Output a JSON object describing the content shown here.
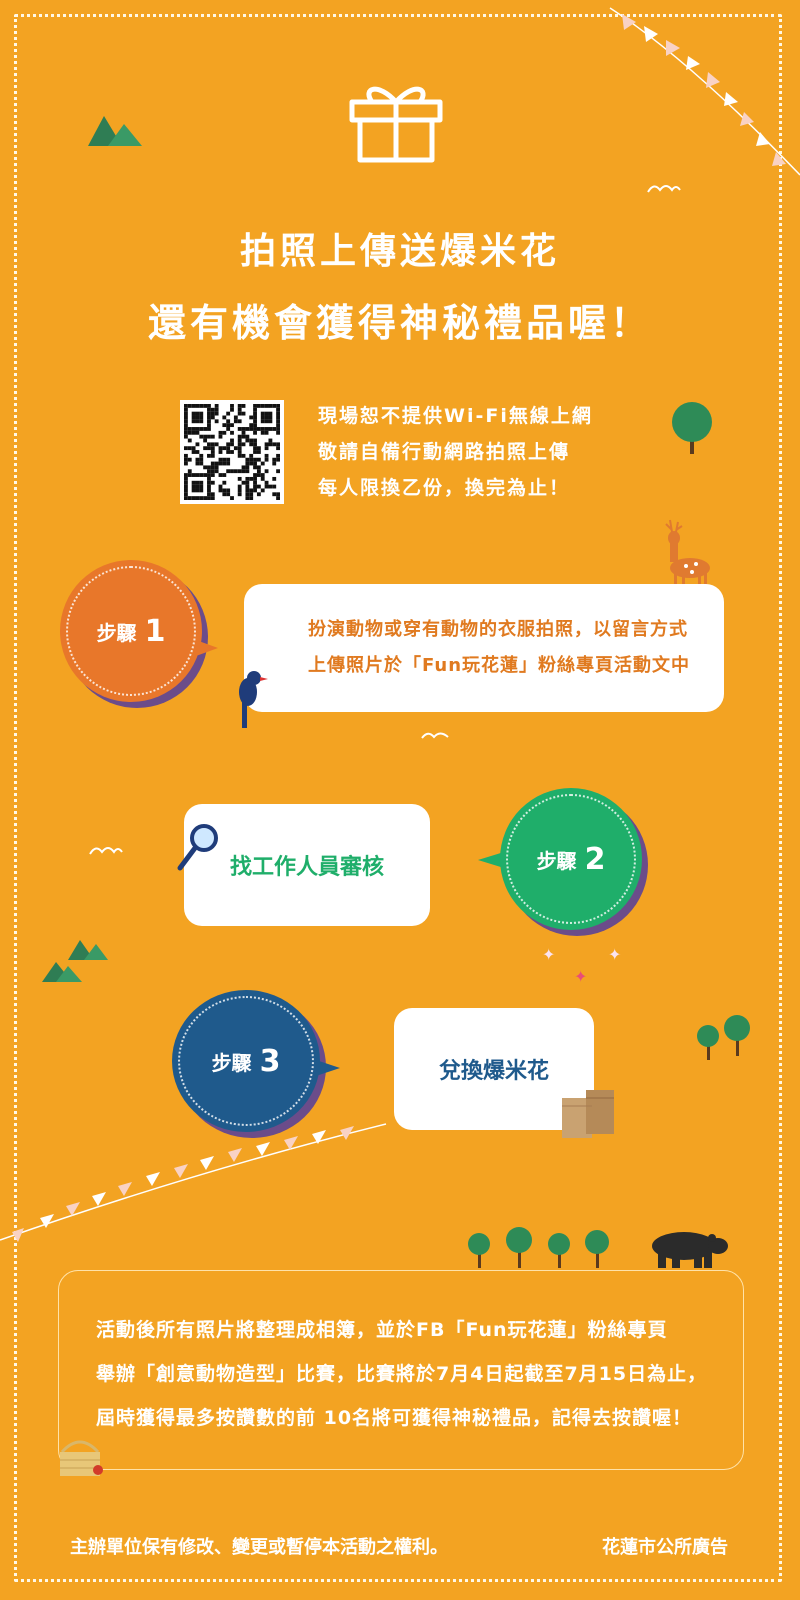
{
  "headline": {
    "line1": "拍照上傳送爆米花",
    "line2": "還有機會獲得神秘禮品喔！"
  },
  "notes": [
    "現場恕不提供Wi-Fi無線上網",
    "敬請自備行動網路拍照上傳",
    "每人限換乙份，換完為止！"
  ],
  "steps": [
    {
      "label": "步驟",
      "number": "1",
      "color": "#e8772a",
      "text_lines": [
        "扮演動物或穿有動物的衣服拍照，以留言方式",
        "上傳照片於「Fun玩花蓮」粉絲專頁活動文中"
      ]
    },
    {
      "label": "步驟",
      "number": "2",
      "color": "#1fae6a",
      "text": "找工作人員審核",
      "text_color": "#1fae6a"
    },
    {
      "label": "步驟",
      "number": "3",
      "color": "#1f5a8c",
      "text": "兌換爆米花",
      "text_color": "#1f5a8c"
    }
  ],
  "info_lines": [
    "活動後所有照片將整理成相簿，並於FB「Fun玩花蓮」粉絲專頁",
    "舉辦「創意動物造型」比賽，比賽將於7月4日起截至7月15日為止，",
    "屆時獲得最多按讚數的前 10名將可獲得神秘禮品，記得去按讚喔！"
  ],
  "footer": {
    "left": "主辦單位保有修改、變更或暫停本活動之權利。",
    "right": "花蓮市公所廣告"
  },
  "colors": {
    "background": "#f3a322",
    "orange": "#e8772a",
    "green": "#1fae6a",
    "blue": "#1f5a8c",
    "tree": "#2e8b57"
  }
}
